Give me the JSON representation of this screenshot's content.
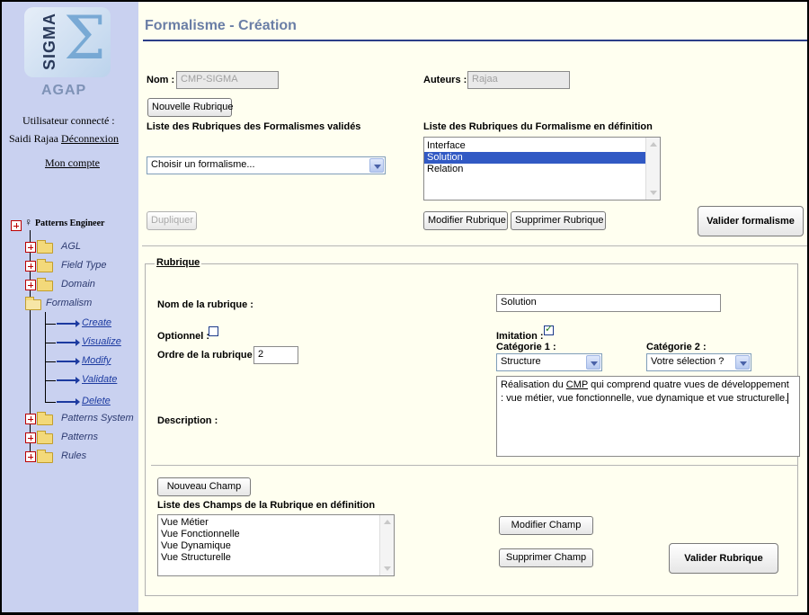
{
  "sidebar": {
    "logo_text": "SIGMA",
    "app_name": "AGAP",
    "user_label": "Utilisateur connecté :",
    "user_name": "Saidi Rajaa",
    "logout_link": "Déconnexion",
    "account_link": "Mon compte",
    "tree_root": "Patterns Engineer",
    "tree_items": [
      "AGL",
      "Field Type",
      "Domain",
      "Formalism",
      "Patterns System",
      "Patterns",
      "Rules"
    ],
    "formalism_children": [
      "Create",
      "Visualize",
      "Modify",
      "Validate",
      "Delete"
    ]
  },
  "page": {
    "title": "Formalisme - Création"
  },
  "form": {
    "nom_label": "Nom :",
    "nom_value": "CMP-SIGMA",
    "auteurs_label": "Auteurs :",
    "auteurs_value": "Rajaa",
    "nouvelle_rubrique_button": "Nouvelle Rubrique",
    "valid_list_label": "Liste des Rubriques des Formalismes validés",
    "def_list_label": "Liste des Rubriques du Formalisme en définition",
    "formalisme_select": "Choisir un formalisme...",
    "def_list_items": [
      "Interface",
      "Solution",
      "Relation"
    ],
    "def_list_selected": "Solution",
    "dupliquer_button": "Dupliquer",
    "modifier_rubrique_button": "Modifier Rubrique",
    "supprimer_rubrique_button": "Supprimer Rubrique",
    "valider_formalisme_button": "Valider formalisme"
  },
  "rubrique": {
    "legend": "Rubrique",
    "nom_label": "Nom de la rubrique :",
    "nom_value": "Solution",
    "optionnel_label": "Optionnel :",
    "optionnel_checked": false,
    "imitation_label": "Imitation :",
    "imitation_checked": true,
    "ordre_label": "Ordre de la rubrique :",
    "ordre_value": "2",
    "categorie1_label": "Catégorie 1 :",
    "categorie1_value": "Structure",
    "categorie2_label": "Catégorie 2 :",
    "categorie2_value": "Votre sélection ?",
    "description_label": "Description :",
    "description_prefix": "Réalisation du ",
    "description_cmp": "CMP",
    "description_line1_rest": " qui comprend quatre vues de développement",
    "description_line2": ": vue métier, vue fonctionnelle, vue dynamique et vue structurelle.",
    "nouveau_champ_button": "Nouveau Champ",
    "champs_list_label": "Liste des Champs de la Rubrique en définition",
    "champs_items": [
      "Vue Métier",
      "Vue Fonctionnelle",
      "Vue Dynamique",
      "Vue Structurelle"
    ],
    "modifier_champ_button": "Modifier Champ",
    "supprimer_champ_button": "Supprimer Champ",
    "valider_rubrique_button": "Valider Rubrique"
  }
}
